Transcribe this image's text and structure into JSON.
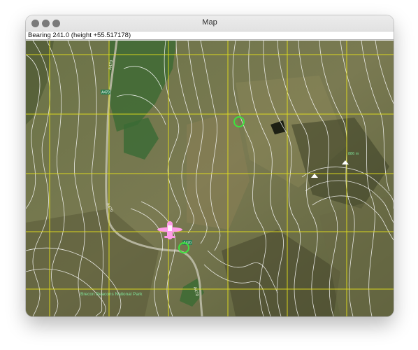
{
  "window": {
    "title": "Map"
  },
  "status": {
    "text": "Bearing 241.0 (height +55.517178)"
  },
  "map": {
    "park_label": "Brecon Beacons National Park",
    "road_labels": [
      "A470",
      "A470",
      "A470"
    ],
    "road_numbers": [
      "A470",
      "A470"
    ],
    "summit_label": "886 m"
  },
  "colors": {
    "grid": "#e6e21a",
    "contour": "#ffffff",
    "waypoint": "#3ee23e",
    "aircraft": "#ff9ce8",
    "label": "#7fe39a"
  },
  "icons": {
    "aircraft": "aircraft-icon",
    "waypoint": "circle-marker-icon",
    "summit": "peak-icon"
  }
}
